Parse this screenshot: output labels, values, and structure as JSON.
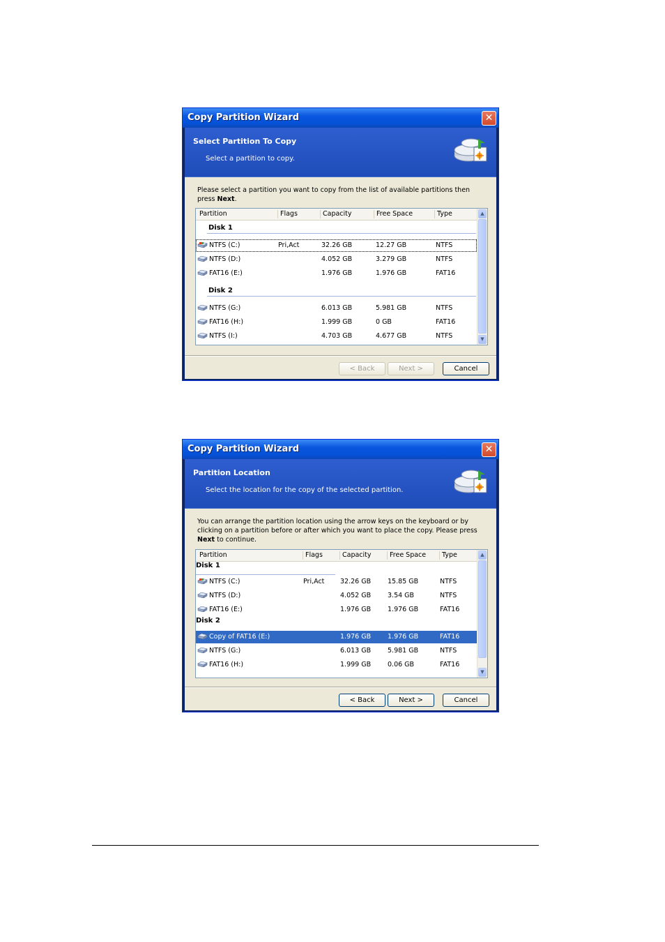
{
  "wizard1": {
    "title": "Copy Partition Wizard",
    "close_glyph": "✕",
    "header_title": "Select Partition To Copy",
    "header_subtitle": "Select a partition to copy.",
    "instr_text": "Please select a partition you want to copy from the list of available partitions then press ",
    "instr_bold": "Next",
    "instr_end": ".",
    "columns": [
      "Partition",
      "Flags",
      "Capacity",
      "Free Space",
      "Type"
    ],
    "disk1_label": "Disk 1",
    "disk2_label": "Disk 2",
    "rows": [
      {
        "name": "NTFS (C:)",
        "flags": "Pri,Act",
        "capacity": "32.26 GB",
        "free": "12.27 GB",
        "type": "NTFS"
      },
      {
        "name": "NTFS (D:)",
        "flags": "",
        "capacity": "4.052 GB",
        "free": "3.279 GB",
        "type": "NTFS"
      },
      {
        "name": "FAT16 (E:)",
        "flags": "",
        "capacity": "1.976 GB",
        "free": "1.976 GB",
        "type": "FAT16"
      },
      {
        "name": "NTFS (G:)",
        "flags": "",
        "capacity": "6.013 GB",
        "free": "5.981 GB",
        "type": "NTFS"
      },
      {
        "name": "FAT16 (H:)",
        "flags": "",
        "capacity": "1.999 GB",
        "free": "0 GB",
        "type": "FAT16"
      },
      {
        "name": "NTFS (I:)",
        "flags": "",
        "capacity": "4.703 GB",
        "free": "4.677 GB",
        "type": "NTFS"
      }
    ],
    "back_label": "< Back",
    "next_label": "Next >",
    "cancel_label": "Cancel"
  },
  "wizard2": {
    "title": "Copy Partition Wizard",
    "close_glyph": "✕",
    "header_title": "Partition Location",
    "header_subtitle": "Select the location for the copy of the selected partition.",
    "instr_text": "You can arrange the partition location using the arrow keys on the keyboard or by clicking on a partition before or after which you want to place the copy. Please press ",
    "instr_bold": "Next",
    "instr_end": " to continue.",
    "columns": [
      "Partition",
      "Flags",
      "Capacity",
      "Free Space",
      "Type"
    ],
    "disk1_label": "Disk 1",
    "disk2_label": "Disk 2",
    "rows": [
      {
        "name": "NTFS (C:)",
        "flags": "Pri,Act",
        "capacity": "32.26 GB",
        "free": "15.85 GB",
        "type": "NTFS"
      },
      {
        "name": "NTFS (D:)",
        "flags": "",
        "capacity": "4.052 GB",
        "free": "3.54 GB",
        "type": "NTFS"
      },
      {
        "name": "FAT16 (E:)",
        "flags": "",
        "capacity": "1.976 GB",
        "free": "1.976 GB",
        "type": "FAT16"
      },
      {
        "name": "Copy of FAT16 (E:)",
        "flags": "",
        "capacity": "1.976 GB",
        "free": "1.976 GB",
        "type": "FAT16"
      },
      {
        "name": "NTFS (G:)",
        "flags": "",
        "capacity": "6.013 GB",
        "free": "5.981 GB",
        "type": "NTFS"
      },
      {
        "name": "FAT16 (H:)",
        "flags": "",
        "capacity": "1.999 GB",
        "free": "0.06 GB",
        "type": "FAT16"
      }
    ],
    "back_label": "< Back",
    "next_label": "Next >",
    "cancel_label": "Cancel"
  },
  "scroll_up_glyph": "▲",
  "scroll_down_glyph": "▼",
  "colors": {
    "title_bar": "#0a57e0",
    "header_band": "#2f5ed0",
    "selection": "#316ac5",
    "dialog_bg": "#ece9d8"
  }
}
